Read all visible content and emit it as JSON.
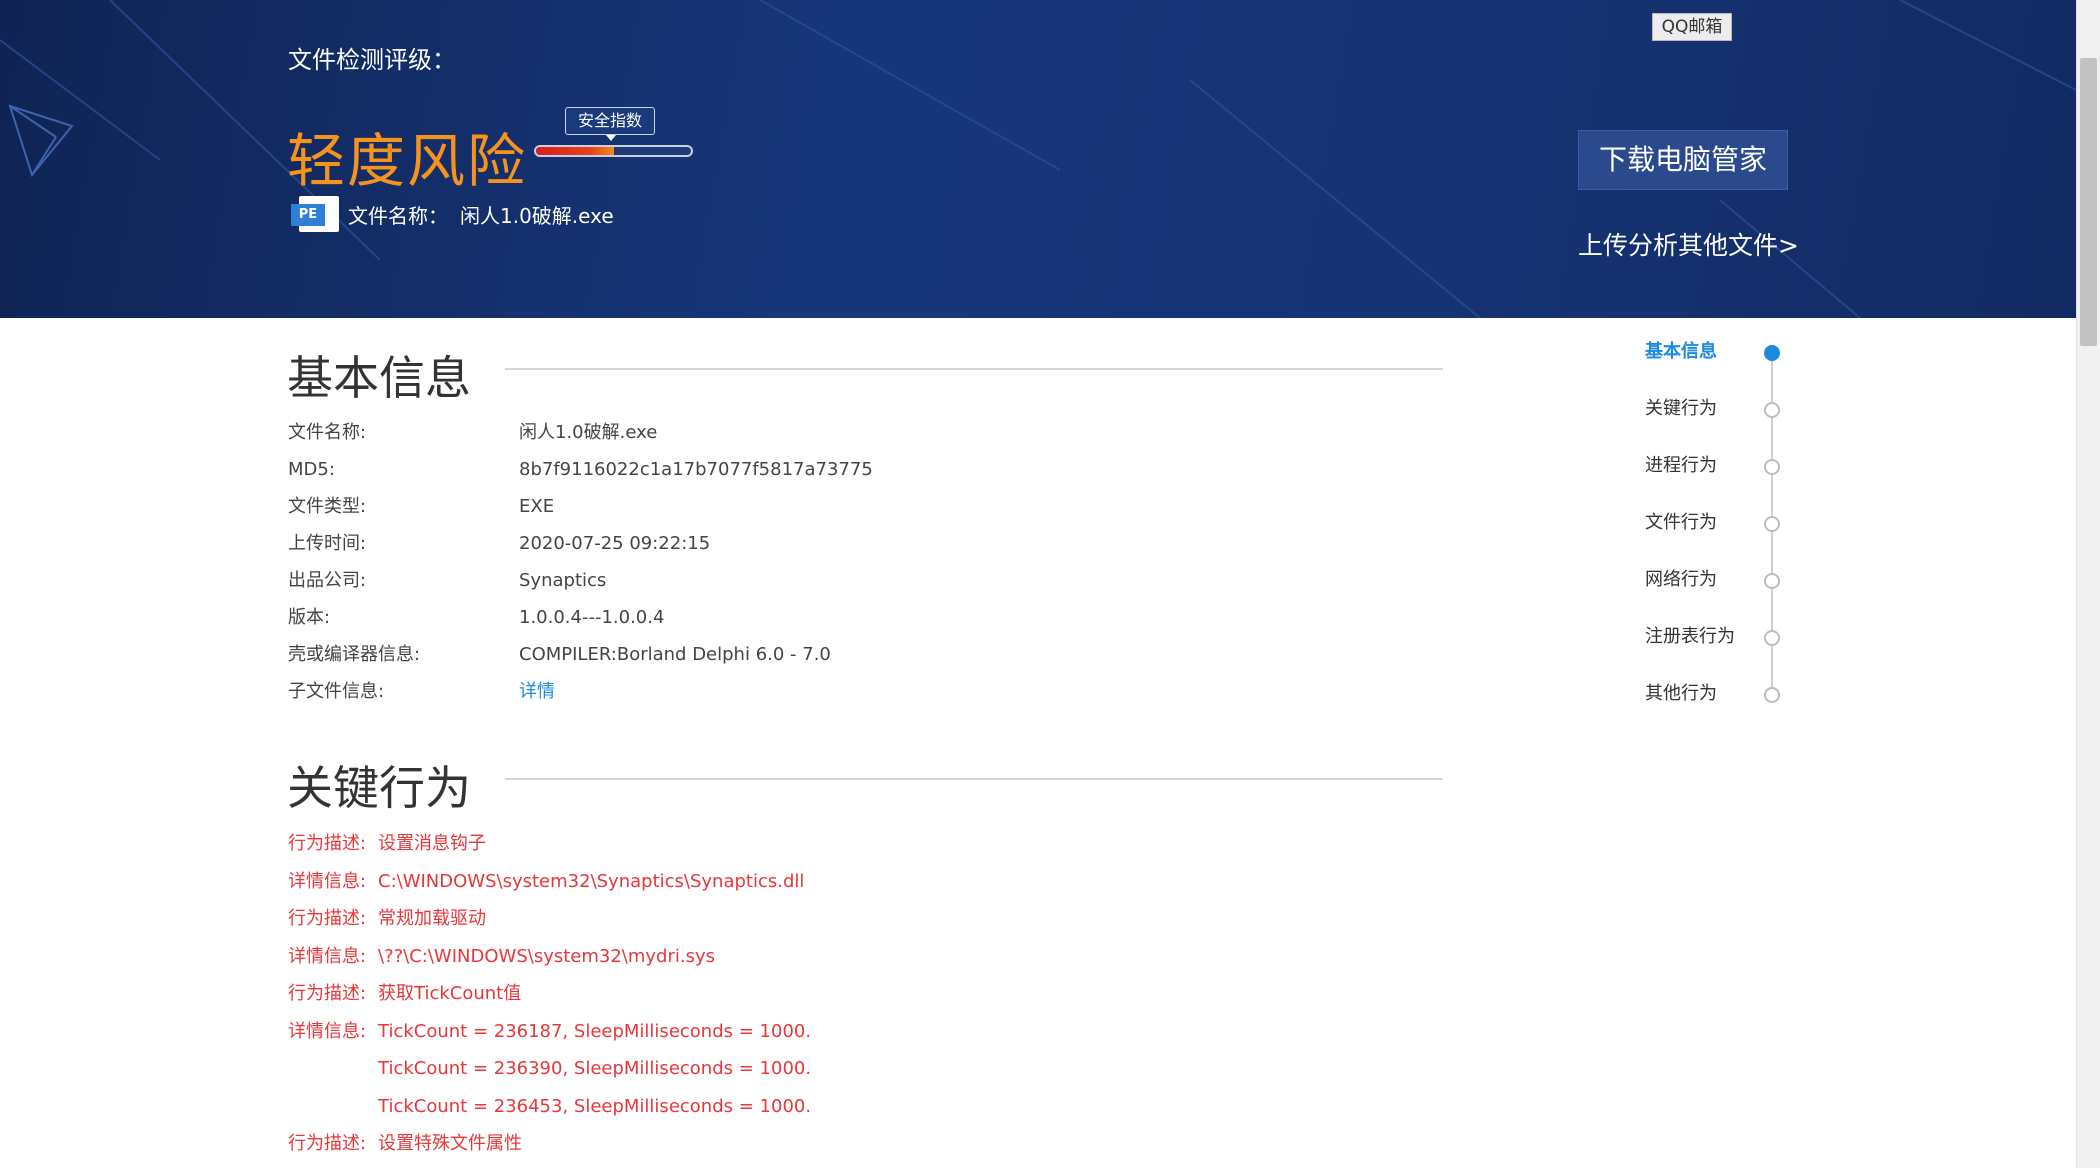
{
  "banner": {
    "title": "文件检测评级：",
    "risk_level": "轻度风险",
    "safety_badge": "安全指数",
    "safety_index_fraction": 0.5,
    "file_name_label": "文件名称：",
    "file_name": "闲人1.0破解.exe",
    "file_icon_text": "PE",
    "qq_mail": "QQ邮箱",
    "download_button": "下载电脑管家",
    "upload_link": "上传分析其他文件>"
  },
  "basic_info": {
    "title": "基本信息",
    "rows": [
      {
        "label": "文件名称:",
        "value": "闲人1.0破解.exe"
      },
      {
        "label": "MD5:",
        "value": "8b7f9116022c1a17b7077f5817a73775"
      },
      {
        "label": "文件类型:",
        "value": "EXE"
      },
      {
        "label": "上传时间:",
        "value": "2020-07-25 09:22:15"
      },
      {
        "label": "出品公司:",
        "value": "Synaptics"
      },
      {
        "label": "版本:",
        "value": "1.0.0.4---1.0.0.4"
      },
      {
        "label": "壳或编译器信息:",
        "value": "COMPILER:Borland Delphi 6.0 - 7.0"
      },
      {
        "label": "子文件信息:",
        "value": "详情"
      }
    ]
  },
  "key_behavior": {
    "title": "关键行为",
    "rows": [
      {
        "label": "行为描述:",
        "value": "设置消息钩子"
      },
      {
        "label": "详情信息:",
        "value": "C:\\WINDOWS\\system32\\Synaptics\\Synaptics.dll"
      },
      {
        "label": "行为描述:",
        "value": "常规加载驱动"
      },
      {
        "label": "详情信息:",
        "value": "\\??\\C:\\WINDOWS\\system32\\mydri.sys"
      },
      {
        "label": "行为描述:",
        "value": "获取TickCount值"
      },
      {
        "label": "详情信息:",
        "value": "TickCount = 236187, SleepMilliseconds = 1000."
      },
      {
        "label": "",
        "value": "TickCount = 236390, SleepMilliseconds = 1000."
      },
      {
        "label": "",
        "value": "TickCount = 236453, SleepMilliseconds = 1000."
      },
      {
        "label": "行为描述:",
        "value": "设置特殊文件属性"
      }
    ]
  },
  "side_nav": {
    "items": [
      {
        "label": "基本信息",
        "active": true
      },
      {
        "label": "关键行为",
        "active": false
      },
      {
        "label": "进程行为",
        "active": false
      },
      {
        "label": "文件行为",
        "active": false
      },
      {
        "label": "网络行为",
        "active": false
      },
      {
        "label": "注册表行为",
        "active": false
      },
      {
        "label": "其他行为",
        "active": false
      }
    ]
  },
  "colors": {
    "banner_bg": "#17367a",
    "risk_orange": "#f5931f",
    "link_blue": "#1a8be0",
    "behavior_red": "#e8373a"
  }
}
